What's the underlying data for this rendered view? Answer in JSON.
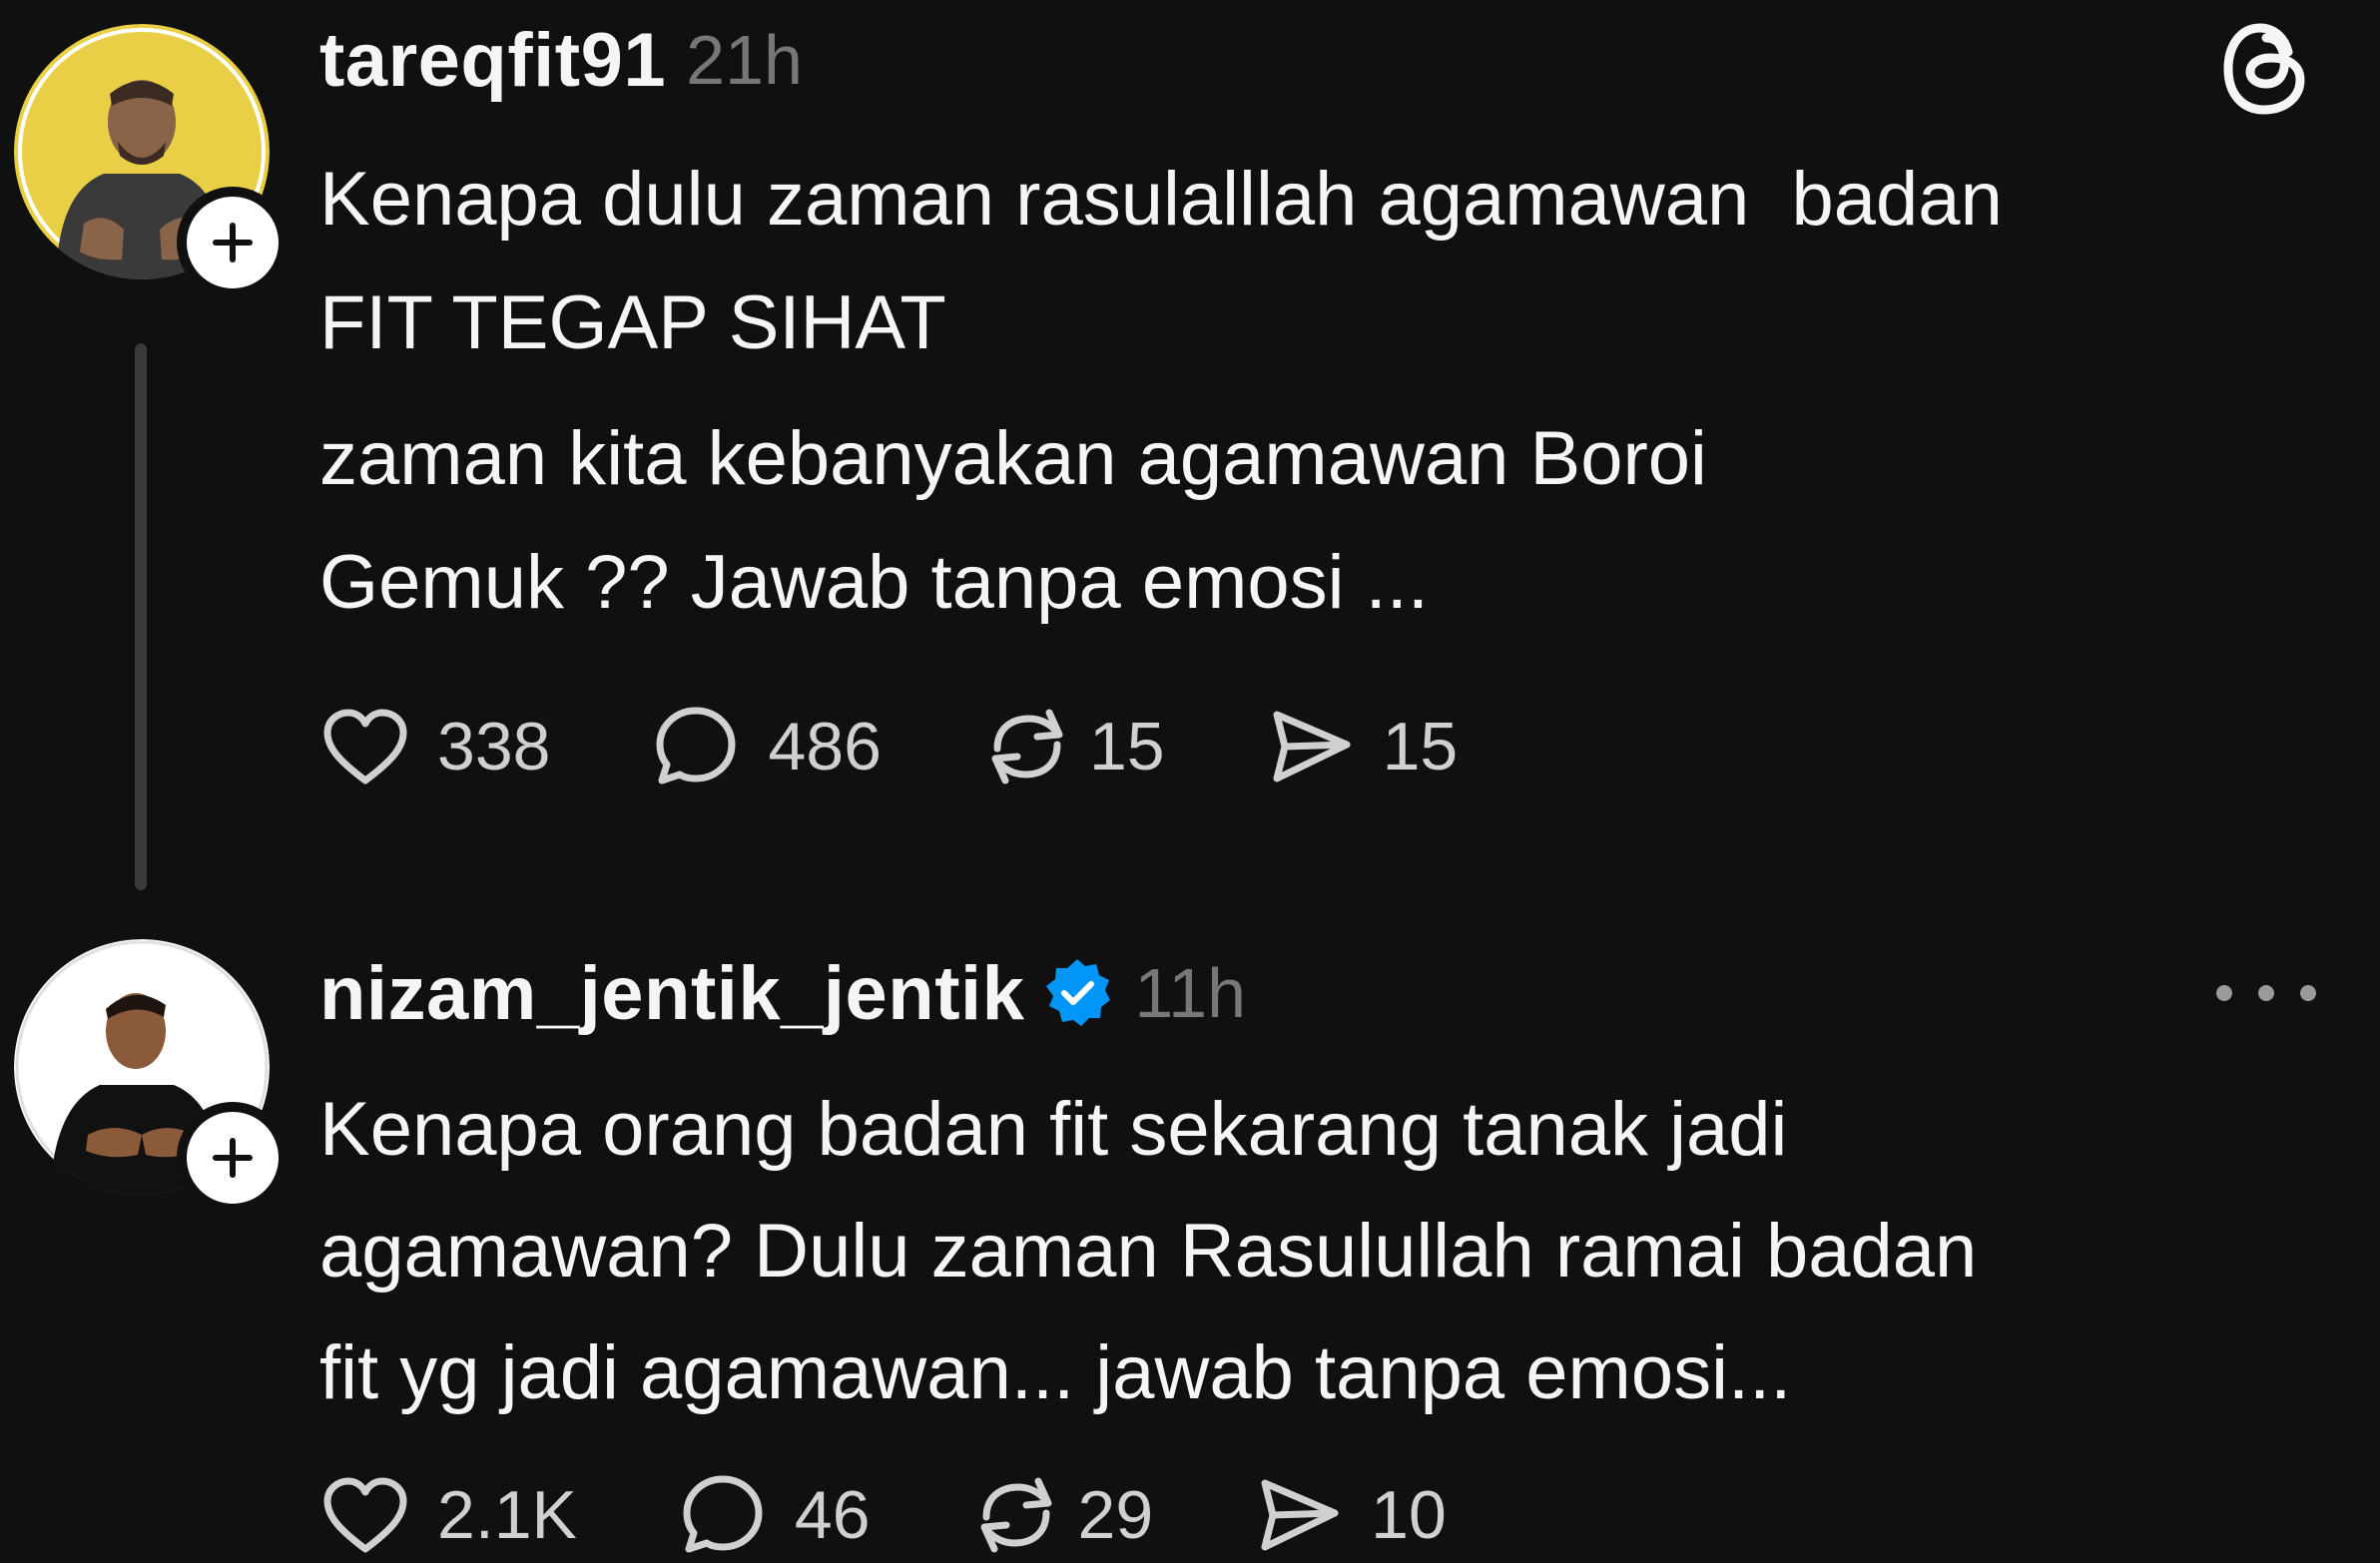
{
  "posts": [
    {
      "username": "tareqfit91",
      "timestamp": "21h",
      "verified": false,
      "lines": [
        "Kenapa dulu zaman rasulalllah agamawan  badan",
        "FIT TEGAP SIHAT",
        "zaman kita kebanyakan agamawan Boroi",
        "Gemuk ?? Jawab tanpa emosi ..."
      ],
      "stats": {
        "likes": "338",
        "replies": "486",
        "reposts": "15",
        "shares": "15"
      },
      "top_right_icon": "threads-logo-icon"
    },
    {
      "username": "nizam_jentik_jentik",
      "timestamp": "11h",
      "verified": true,
      "lines": [
        "Kenapa orang badan fit sekarang tanak jadi",
        "agamawan? Dulu zaman Rasulullah ramai badan",
        "fit yg jadi agamawan... jawab tanpa emosi..."
      ],
      "stats": {
        "likes": "2.1K",
        "replies": "46",
        "reposts": "29",
        "shares": "10"
      },
      "top_right_icon": "more-options-icon"
    }
  ],
  "colors": {
    "background": "#101010",
    "text": "#f3f5f7",
    "muted": "#777777",
    "verified_blue": "#0095f6",
    "avatar_yellow": "#e8cf45"
  }
}
